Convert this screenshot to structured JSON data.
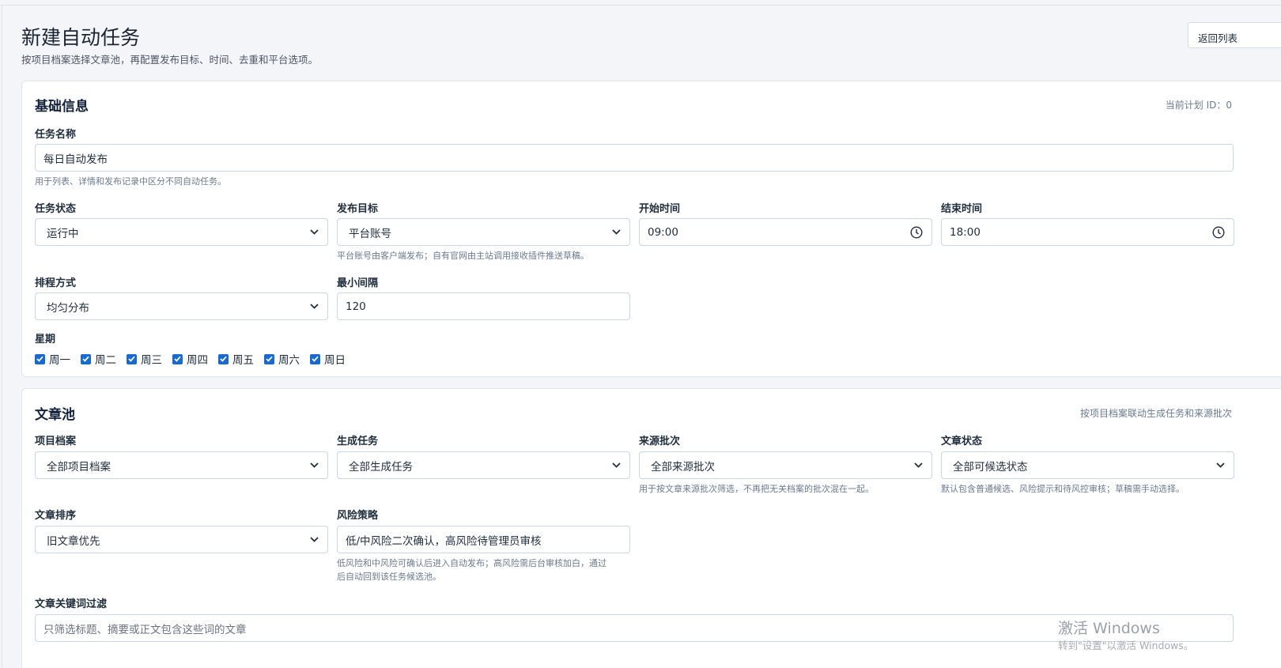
{
  "page": {
    "title": "新建自动任务",
    "subtitle": "按项目档案选择文章池，再配置发布目标、时间、去重和平台选项。",
    "back_label": "返回列表"
  },
  "basic": {
    "title": "基础信息",
    "plan_id_note": "当前计划 ID：0",
    "task_name": {
      "label": "任务名称",
      "value": "每日自动发布",
      "help": "用于列表、详情和发布记录中区分不同自动任务。"
    },
    "status": {
      "label": "任务状态",
      "value": "运行中"
    },
    "target": {
      "label": "发布目标",
      "value": "平台账号",
      "help": "平台账号由客户端发布；自有官网由主站调用接收插件推送草稿。"
    },
    "start_time": {
      "label": "开始时间",
      "value": "09:00"
    },
    "end_time": {
      "label": "结束时间",
      "value": "18:00"
    },
    "schedule": {
      "label": "排程方式",
      "value": "均匀分布"
    },
    "interval": {
      "label": "最小间隔",
      "value": "120"
    },
    "weekdays": {
      "label": "星期",
      "items": [
        {
          "label": "周一",
          "checked": true
        },
        {
          "label": "周二",
          "checked": true
        },
        {
          "label": "周三",
          "checked": true
        },
        {
          "label": "周四",
          "checked": true
        },
        {
          "label": "周五",
          "checked": true
        },
        {
          "label": "周六",
          "checked": true
        },
        {
          "label": "周日",
          "checked": true
        }
      ]
    }
  },
  "pool": {
    "title": "文章池",
    "note": "按项目档案联动生成任务和来源批次",
    "project": {
      "label": "项目档案",
      "value": "全部项目档案"
    },
    "gen_task": {
      "label": "生成任务",
      "value": "全部生成任务"
    },
    "source_batch": {
      "label": "来源批次",
      "value": "全部来源批次",
      "help": "用于按文章来源批次筛选，不再把无关档案的批次混在一起。"
    },
    "article_status": {
      "label": "文章状态",
      "value": "全部可候选状态",
      "help": "默认包含普通候选、风险提示和待风控审核；草稿需手动选择。"
    },
    "sort": {
      "label": "文章排序",
      "value": "旧文章优先"
    },
    "risk": {
      "label": "风险策略",
      "value": "低/中风险二次确认，高风险待管理员审核",
      "help1": "低风险和中风险可确认后进入自动发布；高风险需后台审核加白，通过",
      "help2": "后自动回到该任务候选池。"
    },
    "keyword": {
      "label": "文章关键词过滤",
      "placeholder": "只筛选标题、摘要或正文包含这些词的文章"
    }
  },
  "watermark": {
    "line1": "激活 Windows",
    "line2": "转到\"设置\"以激活 Windows。"
  },
  "colors": {
    "accent": "#1769d6",
    "border": "#c9d6e3",
    "background": "#f3f5f8"
  }
}
